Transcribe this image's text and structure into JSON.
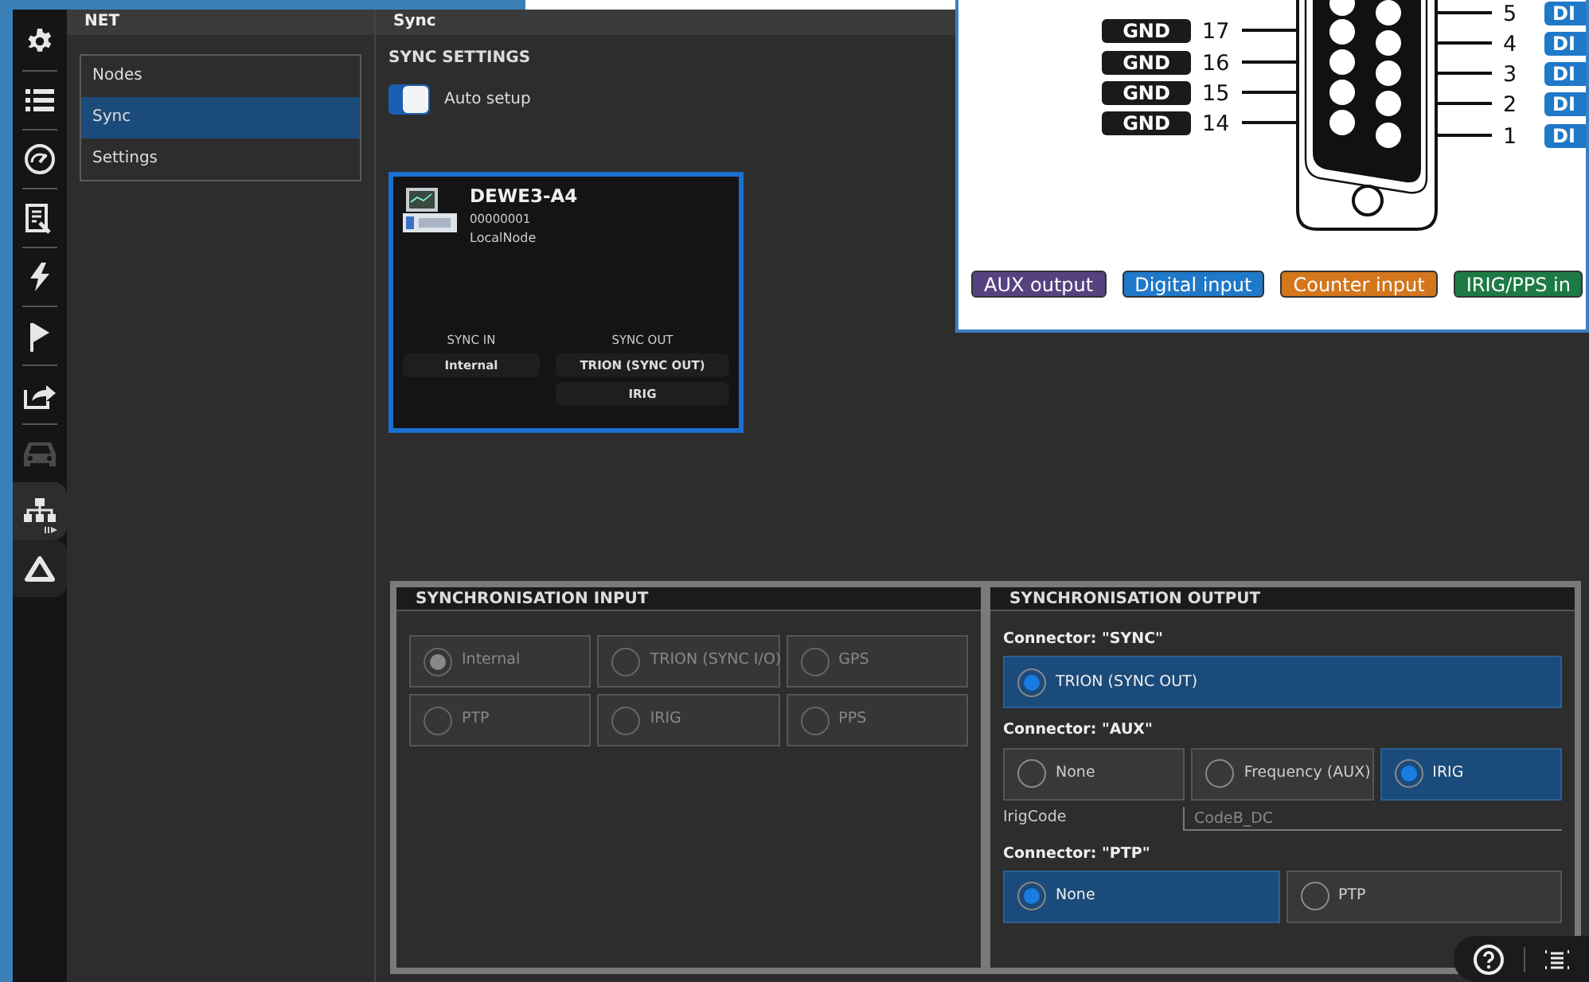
{
  "rail_items": [
    {
      "selected": false,
      "disabled": false
    },
    {
      "selected": false,
      "disabled": false
    },
    {
      "selected": false,
      "disabled": false
    },
    {
      "selected": false,
      "disabled": false
    },
    {
      "selected": false,
      "disabled": false
    },
    {
      "selected": false,
      "disabled": false
    },
    {
      "selected": false,
      "disabled": false
    },
    {
      "selected": false,
      "disabled": true
    },
    {
      "selected": true,
      "disabled": false
    },
    {
      "selected": false,
      "disabled": false
    }
  ],
  "sidebar": {
    "title": "NET",
    "items": [
      {
        "label": "Nodes",
        "selected": false
      },
      {
        "label": "Sync",
        "selected": true
      },
      {
        "label": "Settings",
        "selected": false
      }
    ]
  },
  "main": {
    "title": "Sync",
    "section": "SYNC SETTINGS",
    "auto_setup": {
      "label": "Auto setup",
      "on": true
    }
  },
  "node_card": {
    "name": "DEWE3-A4",
    "serial": "00000001",
    "role": "LocalNode",
    "selected": true,
    "sync_in": {
      "label": "SYNC IN",
      "values": [
        "Internal"
      ]
    },
    "sync_out": {
      "label": "SYNC OUT",
      "values": [
        "TRION (SYNC OUT)",
        "IRIG"
      ]
    }
  },
  "sync_input": {
    "title": "SYNCHRONISATION INPUT",
    "disabled": true,
    "options": [
      {
        "label": "Internal",
        "selected": true
      },
      {
        "label": "TRION (SYNC I/O)",
        "selected": false
      },
      {
        "label": "GPS",
        "selected": false
      },
      {
        "label": "PTP",
        "selected": false
      },
      {
        "label": "IRIG",
        "selected": false
      },
      {
        "label": "PPS",
        "selected": false
      }
    ]
  },
  "sync_output": {
    "title": "SYNCHRONISATION OUTPUT",
    "groups": [
      {
        "label": "Connector: \"SYNC\"",
        "options": [
          {
            "label": "TRION (SYNC OUT)",
            "selected": true
          }
        ]
      },
      {
        "label": "Connector: \"AUX\"",
        "options": [
          {
            "label": "None",
            "selected": false
          },
          {
            "label": "Frequency (AUX)",
            "selected": false
          },
          {
            "label": "IRIG",
            "selected": true
          }
        ],
        "field": {
          "label": "IrigCode",
          "value": "CodeB_DC"
        }
      },
      {
        "label": "Connector: \"PTP\"",
        "options": [
          {
            "label": "None",
            "selected": true
          },
          {
            "label": "PTP",
            "selected": false
          }
        ]
      }
    ]
  },
  "pinout": {
    "left_pins": [
      {
        "label": "GND",
        "number": "17"
      },
      {
        "label": "GND",
        "number": "16"
      },
      {
        "label": "GND",
        "number": "15"
      },
      {
        "label": "GND",
        "number": "14"
      }
    ],
    "right_pins": [
      {
        "number": "5",
        "label": "DI",
        "color": "#1f78c8"
      },
      {
        "number": "4",
        "label": "DI",
        "color": "#1f78c8"
      },
      {
        "number": "3",
        "label": "DI",
        "color": "#1f78c8"
      },
      {
        "number": "2",
        "label": "DI",
        "color": "#1f78c8"
      },
      {
        "number": "1",
        "label": "DI",
        "color": "#1f78c8"
      }
    ],
    "legend": [
      {
        "label": "AUX output",
        "color": "#56427f"
      },
      {
        "label": "Digital input",
        "color": "#1f78c8"
      },
      {
        "label": "Counter input",
        "color": "#d3761c"
      },
      {
        "label": "IRIG/PPS in",
        "color": "#1d7a45"
      }
    ]
  }
}
